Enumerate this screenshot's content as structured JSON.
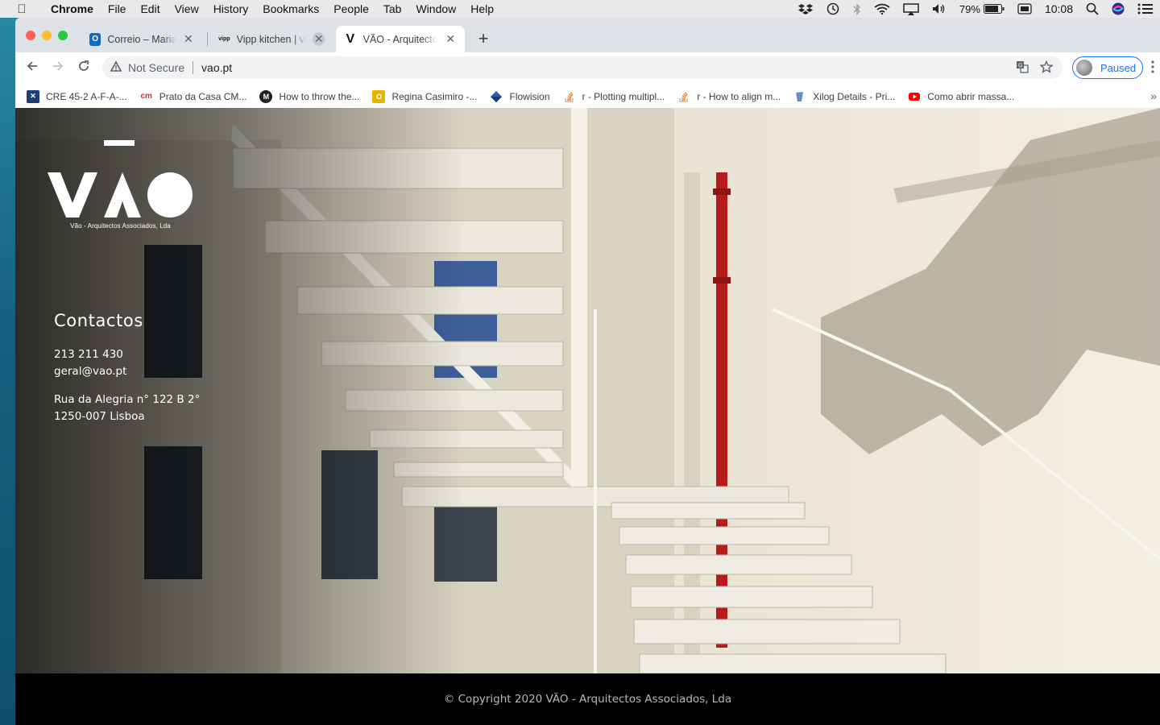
{
  "menubar": {
    "app": "Chrome",
    "items": [
      "File",
      "Edit",
      "View",
      "History",
      "Bookmarks",
      "People",
      "Tab",
      "Window",
      "Help"
    ],
    "battery": "79%",
    "clock": "10:08"
  },
  "tabs": [
    {
      "title": "Correio – Maria R",
      "favicon": "outlook-icon",
      "active": false
    },
    {
      "title": "Vipp kitchen | vip",
      "favicon": "vipp-icon",
      "active": false
    },
    {
      "title": "VÃO - Arquitecto",
      "favicon": "vao-v-icon",
      "active": true
    }
  ],
  "toolbar": {
    "security": "Not Secure",
    "url": "vao.pt",
    "profile_label": "Paused"
  },
  "bookmarks": [
    {
      "label": "CRE 45-2 A-F-A-...",
      "color": "#1c3e72"
    },
    {
      "label": "Prato da Casa CM...",
      "color": "#d62b2b"
    },
    {
      "label": "How to throw the...",
      "color": "#222222"
    },
    {
      "label": "Regina Casimiro -...",
      "color": "#e8b400"
    },
    {
      "label": "Flowision",
      "color": "#2d5fa8"
    },
    {
      "label": "r - Plotting multipl...",
      "color": "#f48024"
    },
    {
      "label": "r - How to align m...",
      "color": "#f48024"
    },
    {
      "label": "Xilog Details - Pri...",
      "color": "#6a8bc7"
    },
    {
      "label": "Como abrir massa...",
      "color": "#ff0000"
    }
  ],
  "page": {
    "logo_text": "VÃO",
    "logo_subtitle": "Vão - Arquitectos Associados, Lda",
    "contacts": {
      "heading": "Contactos",
      "phone": "213 211 430",
      "email": "geral@vao.pt",
      "address_line1": "Rua da Alegria n° 122 B 2°",
      "address_line2": "1250-007 Lisboa"
    },
    "footer": "© Copyright 2020 VÃO - Arquitectos Associados, Lda"
  }
}
